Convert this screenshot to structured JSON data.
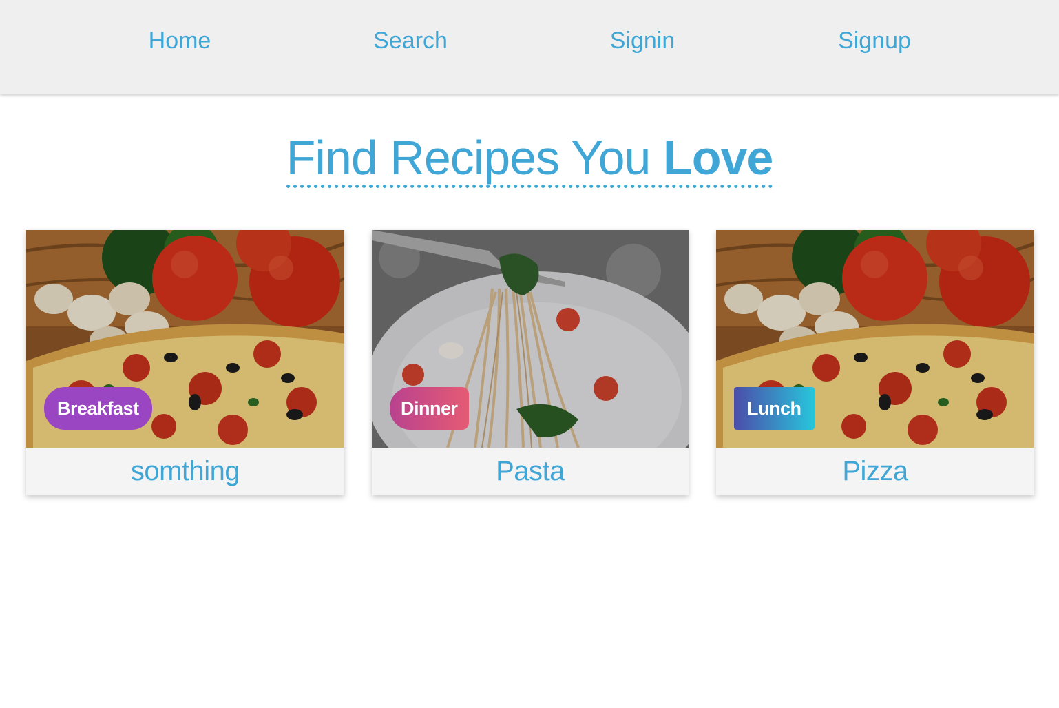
{
  "nav": {
    "items": [
      {
        "label": "Home"
      },
      {
        "label": "Search"
      },
      {
        "label": "Signin"
      },
      {
        "label": "Signup"
      }
    ]
  },
  "headline": {
    "text": "Find Recipes You ",
    "emphasis": "Love"
  },
  "cards": [
    {
      "badge": "Breakfast",
      "title": "somthing",
      "photo": "pizza-photo"
    },
    {
      "badge": "Dinner",
      "title": "Pasta",
      "photo": "pasta-photo"
    },
    {
      "badge": "Lunch",
      "title": "Pizza",
      "photo": "pizza-photo"
    }
  ],
  "colors": {
    "accent": "#3fa6d6",
    "nav_bg": "#efefef",
    "card_bg": "#f4f4f4",
    "breakfast_badge": "#9a46c3",
    "dinner_badge_start": "#b9428f",
    "dinner_badge_end": "#e55b74",
    "lunch_badge_start": "#4c4ca9",
    "lunch_badge_end": "#27c6dc"
  }
}
